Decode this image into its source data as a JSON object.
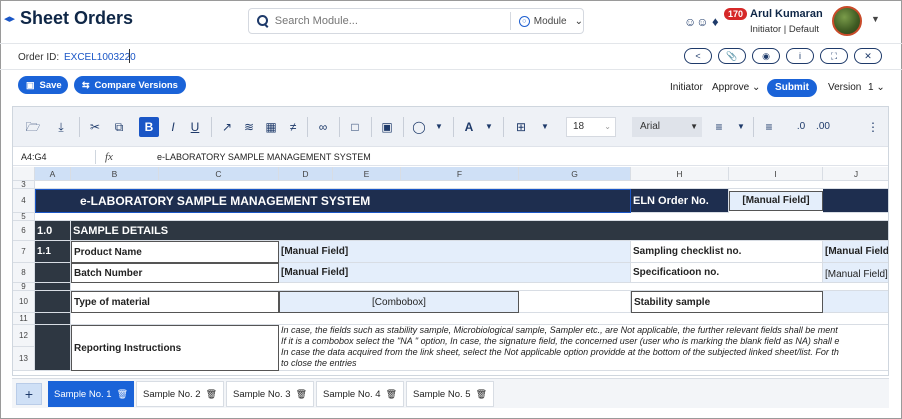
{
  "header": {
    "title": "Sheet Orders",
    "search_placeholder": "Search Module...",
    "module_label": "Module",
    "notification_count": "170",
    "user_name": "Arul Kumaran",
    "user_role": "Initiator | Default"
  },
  "order": {
    "label": "Order ID:",
    "id": "EXCEL1003220"
  },
  "actions": {
    "save": "Save",
    "compare": "Compare Versions",
    "role": "Initiator",
    "approve": "Approve",
    "submit": "Submit",
    "version_label": "Version",
    "version_value": "1"
  },
  "ribbon": {
    "font_size": "18",
    "font_name": "Arial"
  },
  "formula_bar": {
    "cell_ref": "A4:G4",
    "fx": "fx",
    "value": "e-LABORATORY SAMPLE MANAGEMENT SYSTEM"
  },
  "columns": [
    "A",
    "B",
    "C",
    "D",
    "E",
    "F",
    "G",
    "H",
    "I",
    "J"
  ],
  "rows": [
    "3",
    "4",
    "5",
    "6",
    "7",
    "8",
    "9",
    "10",
    "11",
    "12",
    "13"
  ],
  "cells": {
    "title": "e-LABORATORY SAMPLE MANAGEMENT SYSTEM",
    "eln_label": "ELN Order No.",
    "manual_field": "[Manual Field]",
    "section_no": "1.0",
    "section_title": "SAMPLE DETAILS",
    "sub_no": "1.1",
    "product_name": "Product Name",
    "batch_number": "Batch Number",
    "type_of_material": "Type of material",
    "combobox": "[Combobox]",
    "reporting": "Reporting Instructions",
    "sampling_checklist": "Sampling checklist no.",
    "specification": "Specificatioon no.",
    "stability": "Stability sample",
    "manual_field_cut": "[Manual Field",
    "instr_line1": "In case, the fields such as stability sample, Microbiological sample, Sampler etc., are Not applicable, the further relevant fields shall be ment",
    "instr_line2": "If it is a combobox select the \"NA \" option, In case, the signature field, the concerned user (user who is marking the blank field as NA) shall e",
    "instr_line3": "In case the data acquired from the link sheet, select the Not applicable option providde at the bottom of the subjected linked sheet/list. For th",
    "instr_line4": "to close the entries"
  },
  "tabs": [
    {
      "label": "Sample No. 1"
    },
    {
      "label": "Sample No. 2"
    },
    {
      "label": "Sample No. 3"
    },
    {
      "label": "Sample No. 4"
    },
    {
      "label": "Sample No. 5"
    }
  ],
  "colors": {
    "accent": "#1a63d8",
    "dark_row": "#2e3742",
    "navy_row": "#1e2e4f",
    "field_fill": "#e4eefb"
  }
}
